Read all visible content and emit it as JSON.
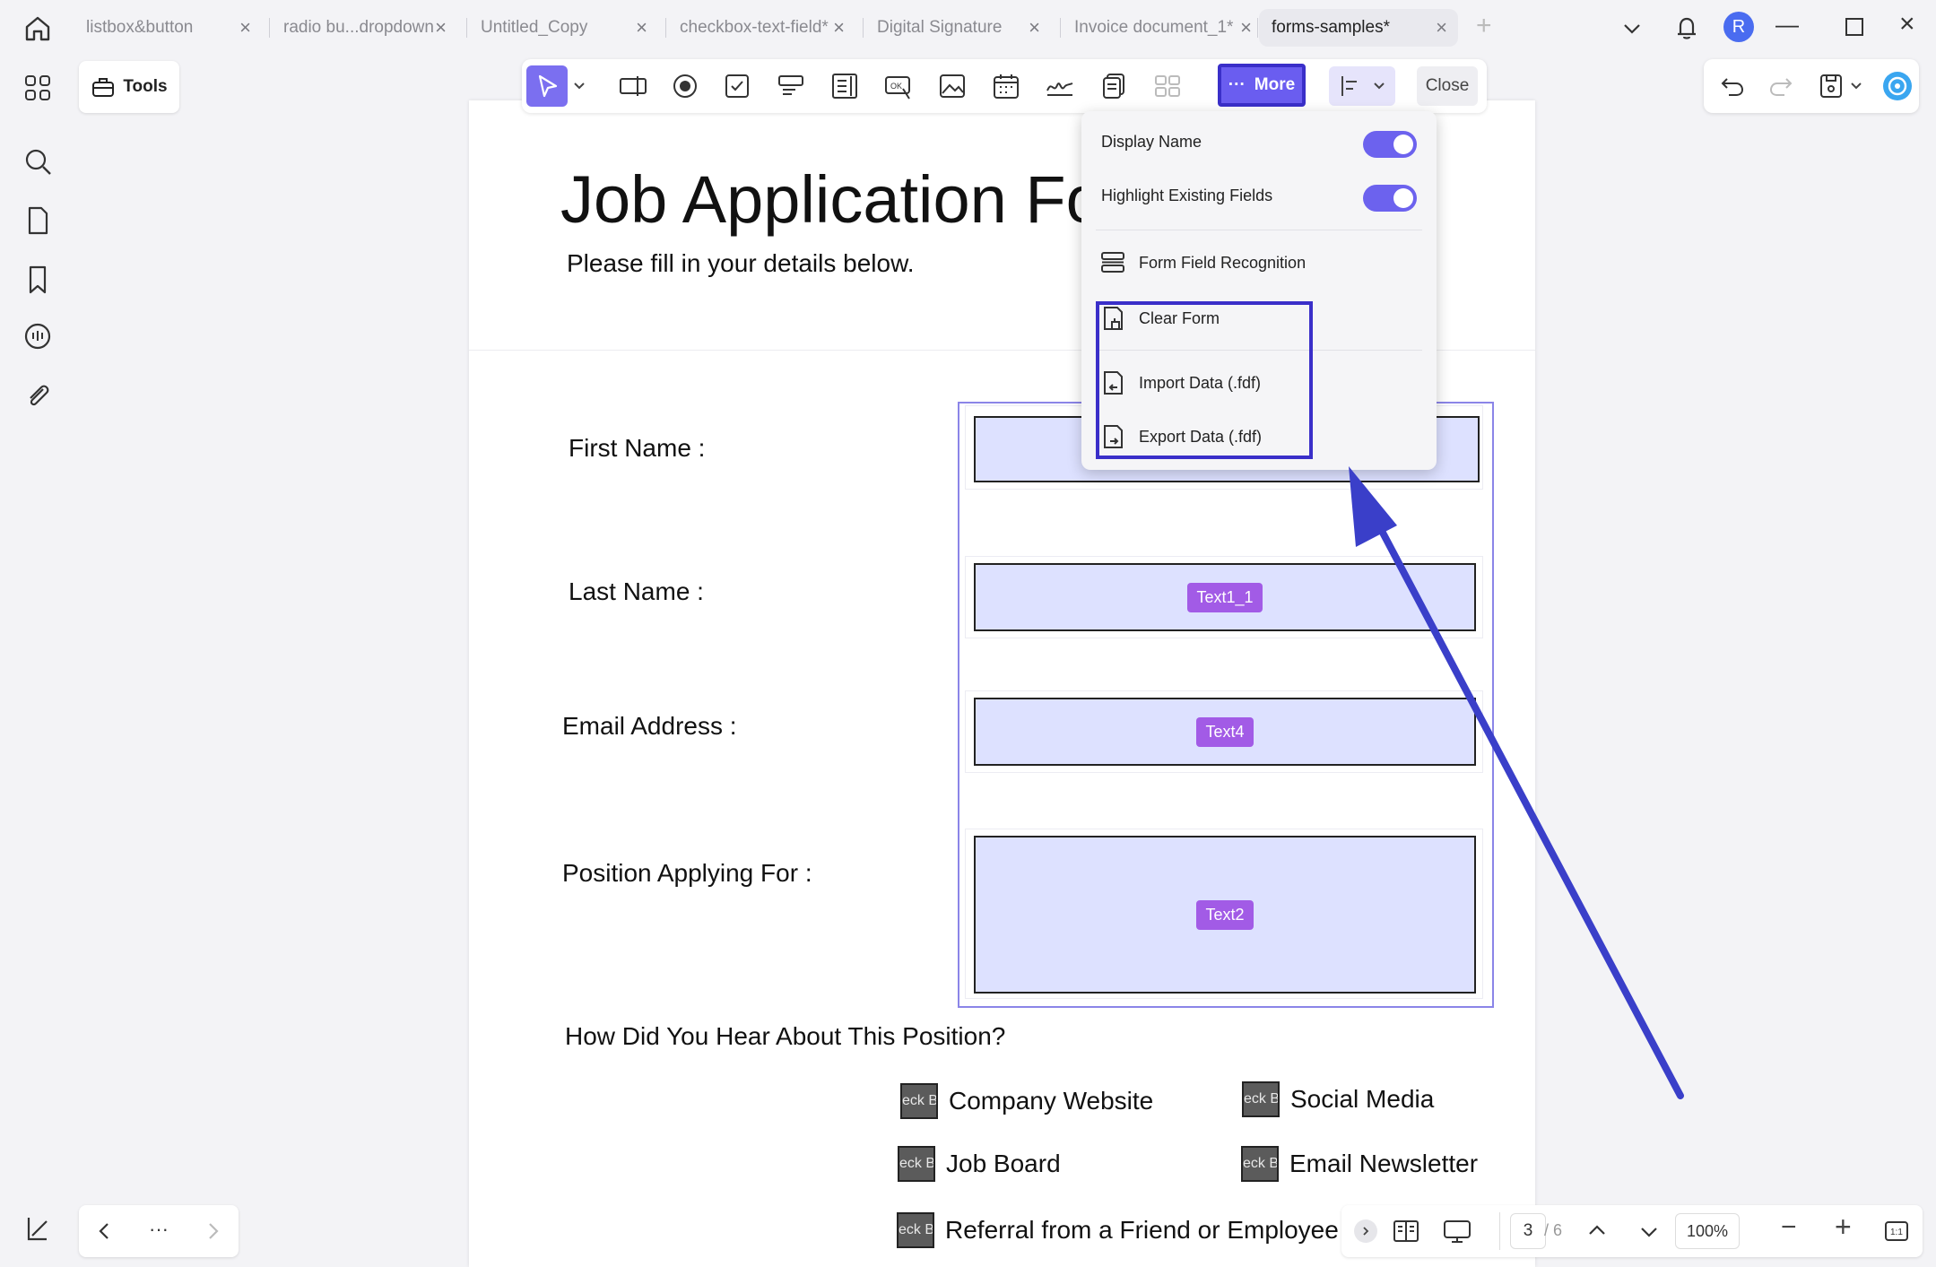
{
  "tabs": [
    {
      "label": "listbox&button"
    },
    {
      "label": "radio bu...dropdown"
    },
    {
      "label": "Untitled_Copy"
    },
    {
      "label": "checkbox-text-field*"
    },
    {
      "label": "Digital Signature"
    },
    {
      "label": "Invoice document_1*"
    },
    {
      "label": "forms-samples*"
    }
  ],
  "window": {
    "avatar_initial": "R"
  },
  "tools": {
    "label": "Tools"
  },
  "toolbar": {
    "more_label": "More",
    "close_label": "Close"
  },
  "document": {
    "title": "Job Application Fo",
    "subtitle": "Please fill in your details below.",
    "fields": [
      {
        "label": "First Name :",
        "tag": ""
      },
      {
        "label": "Last Name :",
        "tag": "Text1_1"
      },
      {
        "label": "Email Address :",
        "tag": "Text4"
      },
      {
        "label": "Position Applying For :",
        "tag": "Text2"
      }
    ],
    "question": "How Did You Hear About This Position?",
    "checkbox_box_text": "eck Bo",
    "checkboxes": [
      {
        "label": "Company Website"
      },
      {
        "label": "Social Media"
      },
      {
        "label": "Job Board"
      },
      {
        "label": "Email Newsletter"
      },
      {
        "label": "Referral from a Friend or Employee"
      }
    ]
  },
  "more_menu": {
    "items": [
      {
        "label": "Display Name"
      },
      {
        "label": "Highlight Existing Fields"
      },
      {
        "label": "Form Field Recognition"
      },
      {
        "label": "Clear Form"
      },
      {
        "label": "Import Data (.fdf)"
      },
      {
        "label": "Export Data (.fdf)"
      }
    ]
  },
  "pagination": {
    "current": "3",
    "total": "/ 6",
    "zoom": "100%",
    "ellipsis": "···"
  },
  "colors": {
    "accent": "#6c62ee",
    "highlight_box": "#3a2fc9",
    "field_fill": "#dde1ff",
    "field_tag": "#a25be6"
  }
}
